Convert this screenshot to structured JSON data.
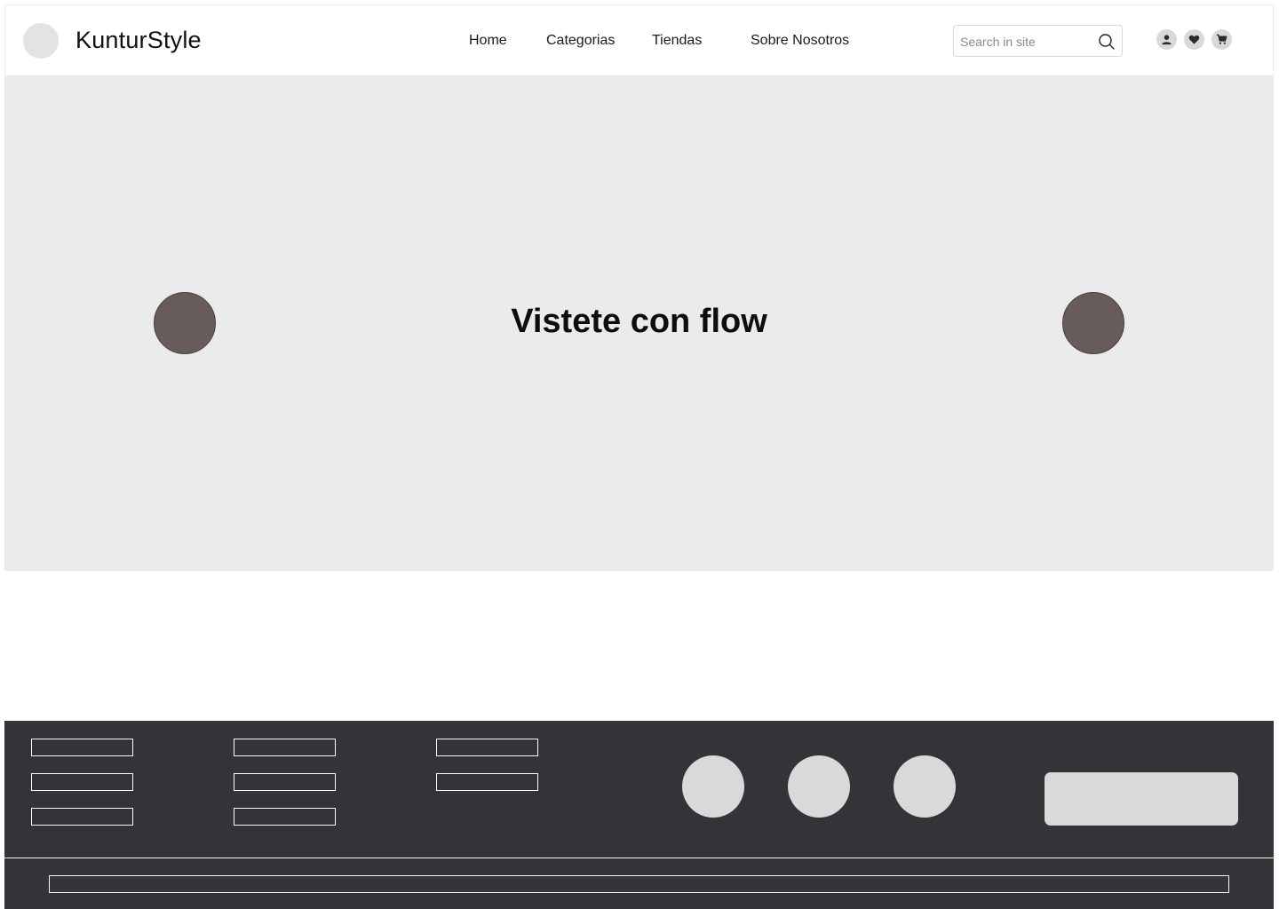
{
  "header": {
    "brand": "KunturStyle",
    "nav": [
      "Home",
      "Categorias",
      "Tiendas",
      "Sobre Nosotros"
    ],
    "search": {
      "placeholder": "Search in site",
      "value": ""
    },
    "icons": [
      "user-icon",
      "heart-icon",
      "cart-icon"
    ]
  },
  "hero": {
    "title": "Vistete con flow",
    "arrow_color": "#675c5a"
  },
  "footer": {
    "background": "#333438"
  }
}
